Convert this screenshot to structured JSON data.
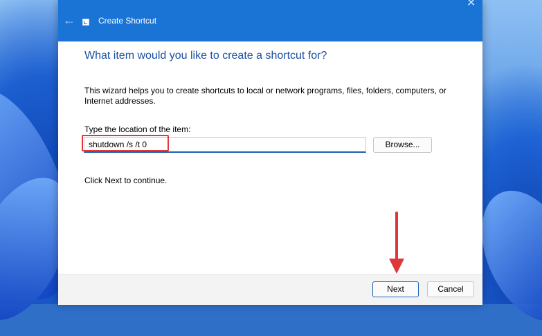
{
  "window": {
    "title": "Create Shortcut",
    "back_icon": "arrow-left-icon",
    "app_icon": "shortcut-icon",
    "close_icon": "close-icon",
    "accent_color": "#1a74d6"
  },
  "content": {
    "heading": "What item would you like to create a shortcut for?",
    "description": "This wizard helps you to create shortcuts to local or network programs, files, folders, computers, or Internet addresses.",
    "location_label": "Type the location of the item:",
    "location_value": "shutdown /s /t 0",
    "browse_label": "Browse...",
    "continue_text": "Click Next to continue."
  },
  "footer": {
    "next_label": "Next",
    "cancel_label": "Cancel"
  },
  "annotations": {
    "highlight_color": "#e0373a",
    "arrow_icon": "red-arrow-down-icon"
  }
}
